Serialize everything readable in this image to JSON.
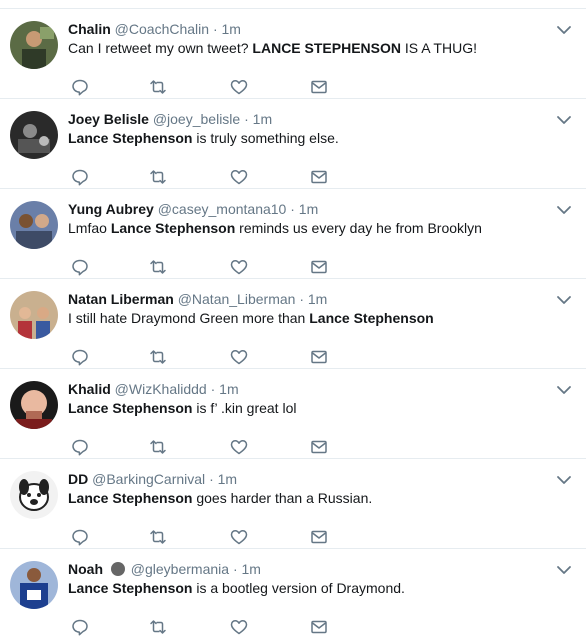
{
  "tweets": [
    {
      "name": "Chalin",
      "handle": "@CoachChalin",
      "dot": "·",
      "time": "1m",
      "badge": false,
      "segments": [
        {
          "t": "Can I retweet my own tweet? "
        },
        {
          "t": "LANCE STEPHENSON",
          "b": true
        },
        {
          "t": " IS A THUG!"
        }
      ]
    },
    {
      "name": "Joey Belisle",
      "handle": "@joey_belisle",
      "dot": "·",
      "time": "1m",
      "badge": false,
      "segments": [
        {
          "t": "Lance Stephenson",
          "b": true
        },
        {
          "t": " is truly something else."
        }
      ]
    },
    {
      "name": "Yung Aubrey",
      "handle": "@casey_montana10",
      "dot": "·",
      "time": "1m",
      "badge": false,
      "segments": [
        {
          "t": "Lmfao "
        },
        {
          "t": "Lance Stephenson",
          "b": true
        },
        {
          "t": " reminds us every day he from Brooklyn"
        }
      ]
    },
    {
      "name": "Natan Liberman",
      "handle": "@Natan_Liberman",
      "dot": "·",
      "time": "1m",
      "badge": false,
      "segments": [
        {
          "t": "I still hate Draymond Green more than "
        },
        {
          "t": "Lance Stephenson",
          "b": true
        }
      ]
    },
    {
      "name": "Khalid",
      "handle": "@WizKhaliddd",
      "dot": "·",
      "time": "1m",
      "badge": false,
      "segments": [
        {
          "t": "Lance Stephenson",
          "b": true
        },
        {
          "t": " is f’ .kin great lol"
        }
      ]
    },
    {
      "name": "DD",
      "handle": "@BarkingCarnival",
      "dot": "·",
      "time": "1m",
      "badge": false,
      "segments": [
        {
          "t": "Lance Stephenson",
          "b": true
        },
        {
          "t": " goes harder than a Russian."
        }
      ]
    },
    {
      "name": "Noah",
      "handle": "@gleybermania",
      "dot": "·",
      "time": "1m",
      "badge": true,
      "segments": [
        {
          "t": "Lance Stephenson",
          "b": true
        },
        {
          "t": " is a bootleg version of Draymond."
        }
      ]
    }
  ],
  "icons": {
    "reply": "reply-icon",
    "retweet": "retweet-icon",
    "like": "heart-icon",
    "dm": "envelope-icon",
    "caret": "chevron-down-icon"
  },
  "colors": {
    "icon": "#657786",
    "name": "#14171a",
    "secondary": "#657786",
    "divider": "#e6ecf0"
  }
}
